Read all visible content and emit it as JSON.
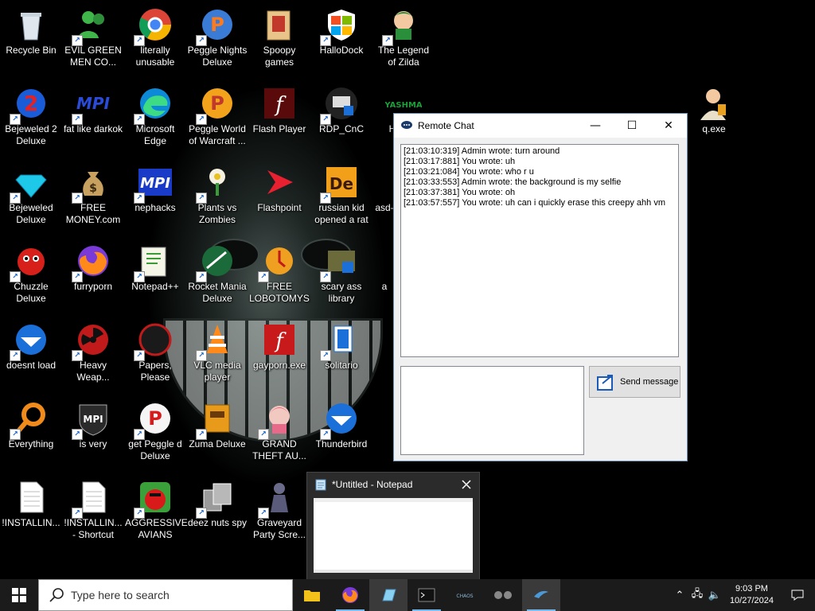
{
  "desktop": {
    "icons": {
      "recycle_bin": "Recycle Bin",
      "evil_green": "EVIL GREEN MEN CO...",
      "literally_unusable": "literally unusable",
      "peggle_nights": "Peggle Nights Deluxe",
      "spoopy": "Spoopy games",
      "hallodock": "HalloDock",
      "zilda": "The Legend of Zilda",
      "bejeweled2": "Bejeweled 2 Deluxe",
      "fat_darkok": "fat like darkok",
      "edge": "Microsoft Edge",
      "peggle_world": "Peggle World of Warcraft ...",
      "flash_player": "Flash Player",
      "rdp": "RDP_CnC",
      "hidden_ran": "Hi Ran",
      "q_exe": "q.exe",
      "bejeweled": "Bejeweled Deluxe",
      "free_money": "FREE MONEY.com",
      "nephacks": "nephacks",
      "pvz": "Plants vs Zombies",
      "flashpoint": "Flashpoint",
      "russian_kid": "russian kid opened a rat",
      "asd": "asd-",
      "chuzzle": "Chuzzle Deluxe",
      "furryporn": "furryporn",
      "notepadpp": "Notepad++",
      "rocket_mania": "Rocket Mania Deluxe",
      "free_lobotomys": "FREE LOBOTOMYS",
      "scary_library": "scary ass library",
      "a_partial": "a",
      "doesnt_load": "doesnt load",
      "heavy_weap": "Heavy Weap...",
      "papers_please": "Papers, Please",
      "vlc": "VLC media player",
      "gayporn": "gayporn.exe",
      "solitario": "solitario",
      "everything": "Everything",
      "is_very": "is very",
      "get_peggle": "get Peggle d Deluxe",
      "zuma": "Zuma Deluxe",
      "gta": "GRAND THEFT AU...",
      "thunderbird": "Thunderbird",
      "installing1": "!INSTALLIN...",
      "installing2": "!INSTALLIN... - Shortcut",
      "aggressive": "AGGRESSIVE AVIANS",
      "deez_nuts": "deez nuts spy",
      "graveyard": "Graveyard Party Scre..."
    }
  },
  "chat_window": {
    "title": "Remote Chat",
    "controls": {
      "minimize": "—",
      "maximize": "☐",
      "close": "✕"
    },
    "messages": [
      "[21:03:10:319] Admin wrote: turn around",
      "[21:03:17:881] You wrote: uh",
      "[21:03:21:084] You wrote: who r u",
      "[21:03:33:553] Admin wrote: the background is my selfie",
      "[21:03:37:381] You wrote: oh",
      "[21:03:57:557] You wrote: uh can i quickly erase this creepy ahh vm"
    ],
    "input_value": "",
    "send_label": "Send message"
  },
  "notepad_preview": {
    "title": "*Untitled - Notepad"
  },
  "taskbar": {
    "search_placeholder": "Type here to search",
    "clock_time": "9:03 PM",
    "clock_date": "10/27/2024",
    "apps": [
      "file-explorer",
      "firefox",
      "notepad",
      "terminal",
      "chaos",
      "glasses",
      "remote-chat"
    ]
  },
  "colors": {
    "taskbar": "#1b1b1b",
    "accent": "#76b9ed",
    "chat_border": "#6b8fb7",
    "window_bg": "#f0f0f0"
  }
}
